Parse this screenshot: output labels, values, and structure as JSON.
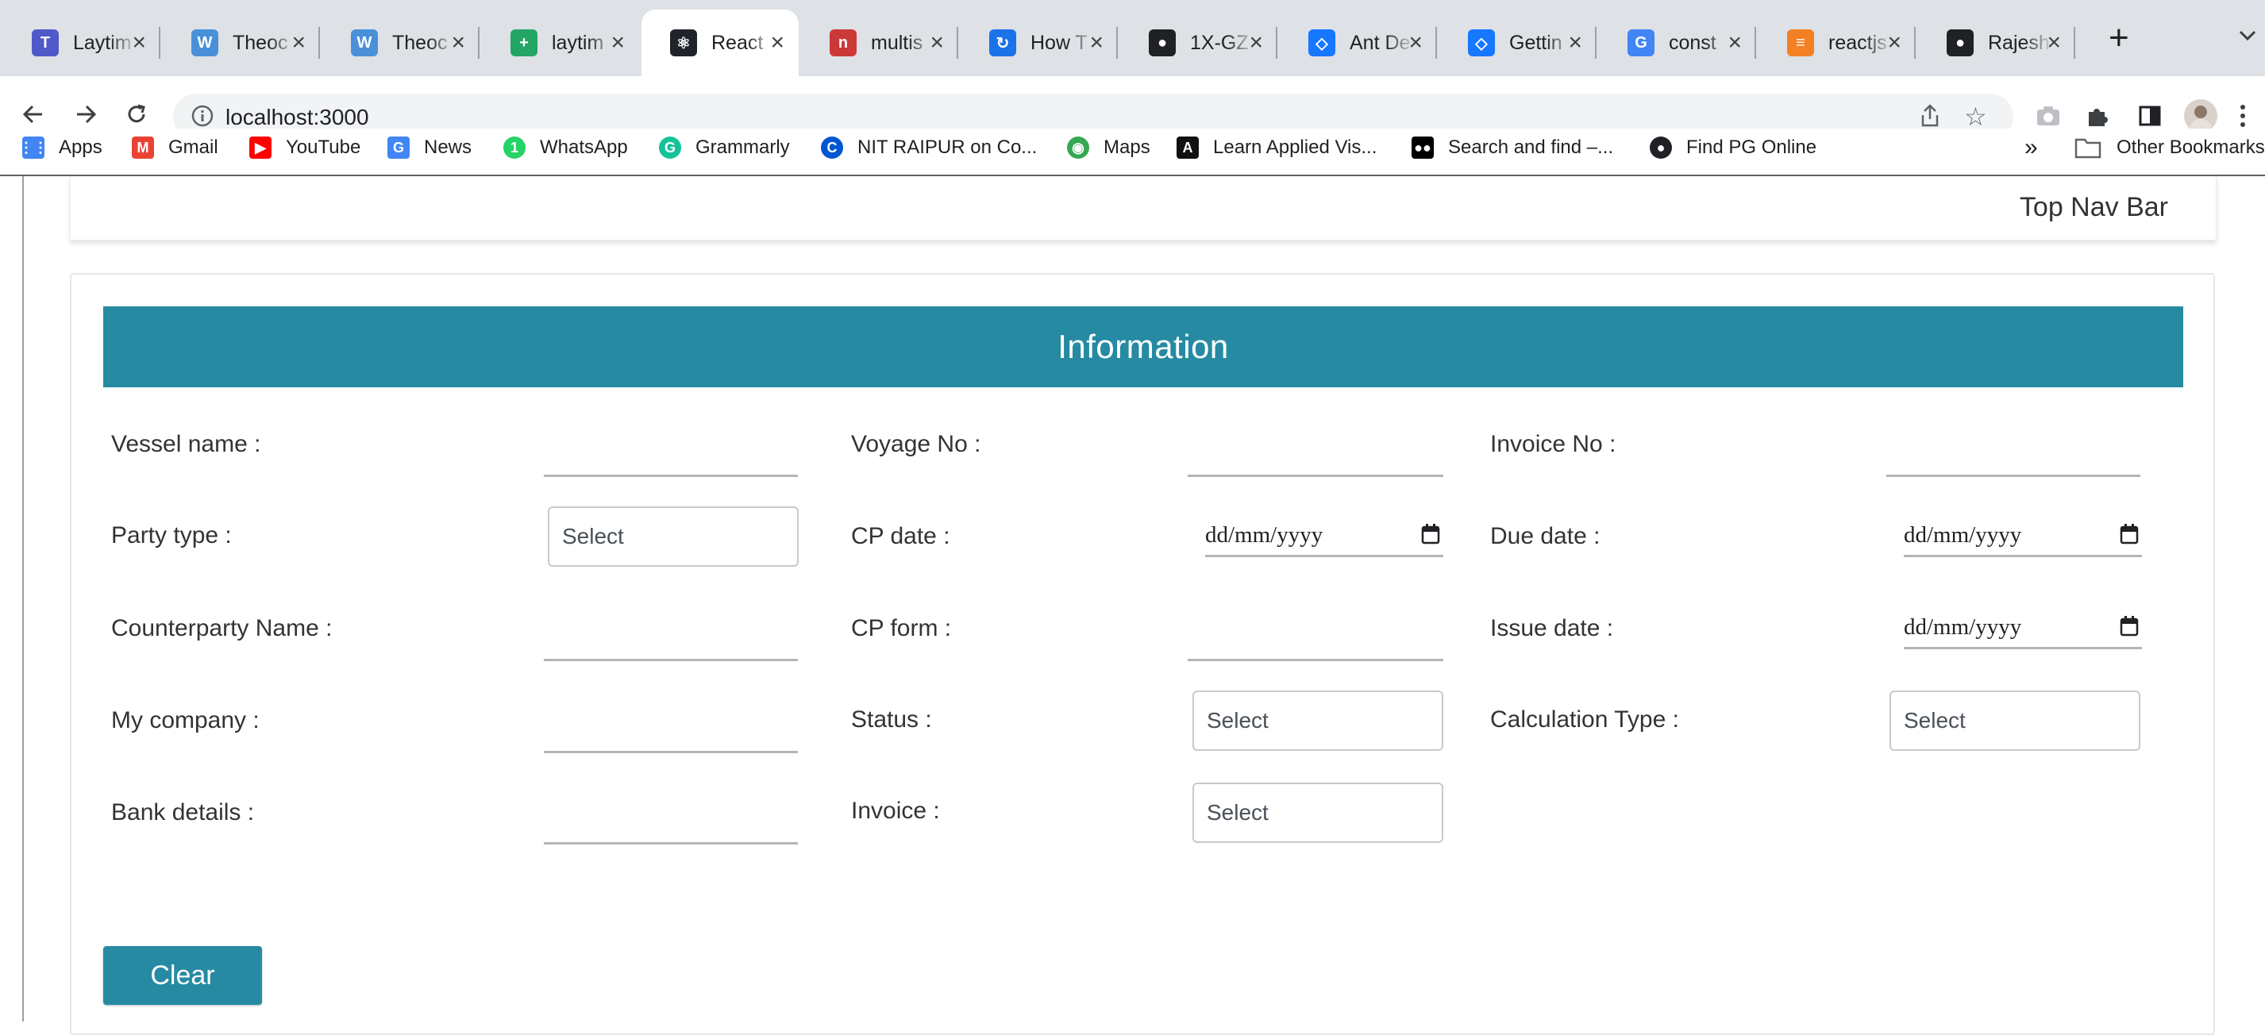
{
  "browser": {
    "tabs": [
      {
        "title": "Laytim",
        "icon": "teams-icon",
        "color": "#5059c9"
      },
      {
        "title": "Theoc",
        "icon": "theoc-icon",
        "color": "#4a90d9"
      },
      {
        "title": "Theoc",
        "icon": "theoc-icon",
        "color": "#4a90d9"
      },
      {
        "title": "laytim",
        "icon": "sheets-icon",
        "color": "#23a566"
      },
      {
        "title": "React",
        "icon": "react-icon",
        "color": "#20232a"
      },
      {
        "title": "multis",
        "icon": "npm-icon",
        "color": "#cb3837"
      },
      {
        "title": "How T",
        "icon": "loop-icon",
        "color": "#1a73e8"
      },
      {
        "title": "1X-GZ",
        "icon": "globe-icon",
        "color": "#202124"
      },
      {
        "title": "Ant De",
        "icon": "ant-design-icon",
        "color": "#1677ff"
      },
      {
        "title": "Gettin",
        "icon": "ant-design-icon",
        "color": "#1677ff"
      },
      {
        "title": "const",
        "icon": "google-icon",
        "color": "#4285f4"
      },
      {
        "title": "reactjs",
        "icon": "stackoverflow-icon",
        "color": "#f48024"
      },
      {
        "title": "Rajesh",
        "icon": "github-icon",
        "color": "#202124"
      }
    ],
    "active_tab_index": 4,
    "new_tab": "+",
    "url": "localhost:3000",
    "bookmarks": [
      {
        "label": "Apps",
        "icon": "apps-grid-icon",
        "color": "#4285f4"
      },
      {
        "label": "Gmail",
        "icon": "gmail-icon",
        "color": "#ea4335"
      },
      {
        "label": "YouTube",
        "icon": "youtube-icon",
        "color": "#ff0000"
      },
      {
        "label": "News",
        "icon": "google-news-icon",
        "color": "#4285f4"
      },
      {
        "label": "WhatsApp",
        "icon": "whatsapp-icon",
        "color": "#25d366"
      },
      {
        "label": "Grammarly",
        "icon": "grammarly-icon",
        "color": "#15c39a"
      },
      {
        "label": "NIT RAIPUR on Co...",
        "icon": "coursera-icon",
        "color": "#0056d2"
      },
      {
        "label": "Maps",
        "icon": "maps-icon",
        "color": "#34a853"
      },
      {
        "label": "Learn Applied Vis...",
        "icon": "applied-vis-icon",
        "color": "#111111"
      },
      {
        "label": "Search and find –...",
        "icon": "medium-icon",
        "color": "#000000"
      },
      {
        "label": "Find PG Online",
        "icon": "globe-icon",
        "color": "#202124"
      }
    ],
    "more_bookmarks": "»",
    "other_bookmarks": "Other Bookmarks"
  },
  "page": {
    "top_nav_title": "Top Nav Bar",
    "banner_title": "Information",
    "fields": {
      "vessel_name": "Vessel name :",
      "voyage_no": "Voyage No :",
      "invoice_no": "Invoice No :",
      "party_type": "Party type :",
      "cp_date": "CP date :",
      "due_date": "Due date :",
      "counterparty_name": "Counterparty Name :",
      "cp_form": "CP form :",
      "issue_date": "Issue date :",
      "my_company": "My company :",
      "status": "Status :",
      "calculation_type": "Calculation Type :",
      "bank_details": "Bank details :",
      "invoice": "Invoice :"
    },
    "select_placeholder": "Select",
    "date_placeholder": "dd/mm/yyyy",
    "clear_label": "Clear"
  },
  "colors": {
    "accent": "#278aa3",
    "tabstrip": "#dee1e6"
  }
}
